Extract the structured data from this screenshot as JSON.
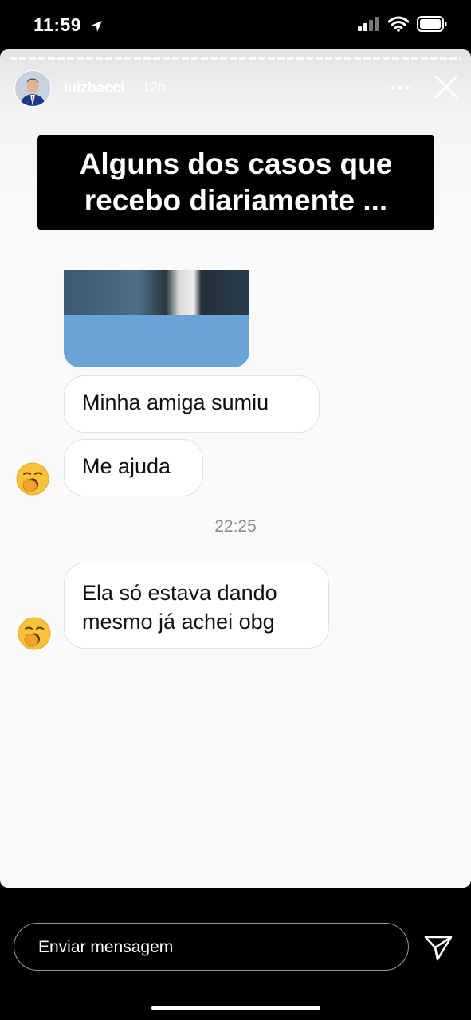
{
  "status_bar": {
    "time": "11:59"
  },
  "story": {
    "username": "luizbacci",
    "time_ago": "12h",
    "caption_line1": "Alguns dos casos que",
    "caption_line2": "recebo diariamente ..."
  },
  "chat": {
    "messages": [
      {
        "text": "Minha amiga sumiu"
      },
      {
        "text": "Me ajuda"
      },
      {
        "line1": "Ela só estava dando",
        "line2": "mesmo já achei obg"
      }
    ],
    "timestamp": "22:25"
  },
  "reply": {
    "placeholder": "Enviar mensagem"
  },
  "colors": {
    "bubble_border": "#e1e1e1",
    "timestamp": "#8e8e8e",
    "photo_blue": "#6aa3d6"
  }
}
